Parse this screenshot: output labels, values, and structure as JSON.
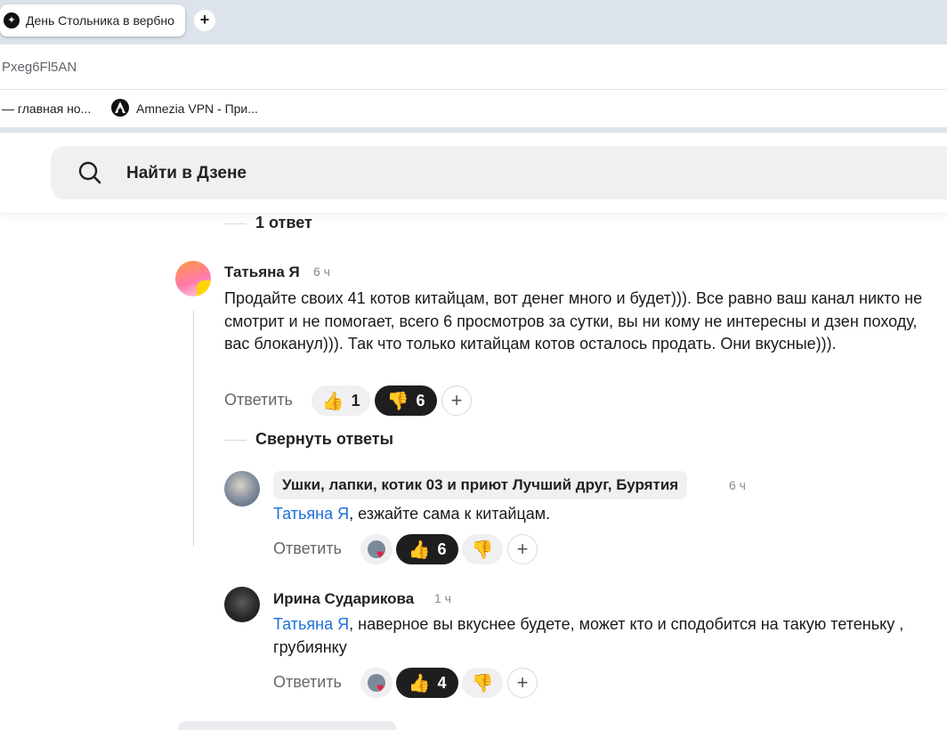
{
  "browser": {
    "tab_title": "День Стольника в вербно",
    "tab_favicon": "✦",
    "new_tab_symbol": "+",
    "url_fragment": "Pxeg6Fl5AN",
    "bookmarks": [
      {
        "label": "— главная но..."
      },
      {
        "label": "Amnezia VPN - При..."
      }
    ]
  },
  "header": {
    "search_placeholder": "Найти в Дзене"
  },
  "thread": {
    "replies_count_label": "1 ответ",
    "collapse_label": "Свернуть ответы"
  },
  "comments": [
    {
      "author": "Татьяна Я",
      "time": "6 ч",
      "text": "Продайте своих 41 котов китайцам, вот денег много и будет))). Все равно ваш канал никто не смотрит и не помогает, всего 6 просмотров за сутки, вы ни кому не интересны и дзен походу, вас блоканул))). Так что только китайцам котов осталось продать. Они вкусные))).",
      "reply_label": "Ответить",
      "likes": "1",
      "dislikes": "6",
      "add_symbol": "+"
    },
    {
      "author": "Ушки, лапки, котик 03 и приют Лучший друг, Бурятия",
      "time": "6 ч",
      "mention": "Татьяна Я",
      "text": ", езжайте сама к китайцам.",
      "reply_label": "Ответить",
      "likes": "6",
      "add_symbol": "+"
    },
    {
      "author": "Ирина Сударикова",
      "time": "1 ч",
      "mention": "Татьяна Я",
      "text": ", наверное вы вкуснее будете, может кто и сподобится на такую тетеньку , грубиянку",
      "reply_label": "Ответить",
      "likes": "4",
      "add_symbol": "+"
    }
  ],
  "icons": {
    "like": "👍",
    "dislike": "👎"
  },
  "colors": {
    "mention": "#1e6fd9",
    "dark_reaction": "#1e1e1e",
    "tab_bar": "#dde3ea"
  }
}
